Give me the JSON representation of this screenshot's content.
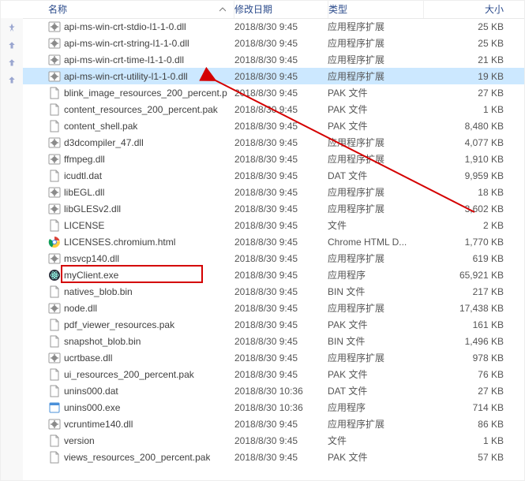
{
  "columns": {
    "name": "名称",
    "date": "修改日期",
    "type": "类型",
    "size": "大小"
  },
  "files": [
    {
      "icon": "gear",
      "name": "api-ms-win-crt-stdio-l1-1-0.dll",
      "date": "2018/8/30 9:45",
      "type": "应用程序扩展",
      "size": "25 KB"
    },
    {
      "icon": "gear",
      "name": "api-ms-win-crt-string-l1-1-0.dll",
      "date": "2018/8/30 9:45",
      "type": "应用程序扩展",
      "size": "25 KB"
    },
    {
      "icon": "gear",
      "name": "api-ms-win-crt-time-l1-1-0.dll",
      "date": "2018/8/30 9:45",
      "type": "应用程序扩展",
      "size": "21 KB"
    },
    {
      "icon": "gear",
      "name": "api-ms-win-crt-utility-l1-1-0.dll",
      "date": "2018/8/30 9:45",
      "type": "应用程序扩展",
      "size": "19 KB",
      "selected": true
    },
    {
      "icon": "file",
      "name": "blink_image_resources_200_percent.p",
      "date": "2018/8/30 9:45",
      "type": "PAK 文件",
      "size": "27 KB"
    },
    {
      "icon": "file",
      "name": "content_resources_200_percent.pak",
      "date": "2018/8/30 9:45",
      "type": "PAK 文件",
      "size": "1 KB"
    },
    {
      "icon": "file",
      "name": "content_shell.pak",
      "date": "2018/8/30 9:45",
      "type": "PAK 文件",
      "size": "8,480 KB"
    },
    {
      "icon": "gear",
      "name": "d3dcompiler_47.dll",
      "date": "2018/8/30 9:45",
      "type": "应用程序扩展",
      "size": "4,077 KB"
    },
    {
      "icon": "gear",
      "name": "ffmpeg.dll",
      "date": "2018/8/30 9:45",
      "type": "应用程序扩展",
      "size": "1,910 KB"
    },
    {
      "icon": "file",
      "name": "icudtl.dat",
      "date": "2018/8/30 9:45",
      "type": "DAT 文件",
      "size": "9,959 KB"
    },
    {
      "icon": "gear",
      "name": "libEGL.dll",
      "date": "2018/8/30 9:45",
      "type": "应用程序扩展",
      "size": "18 KB"
    },
    {
      "icon": "gear",
      "name": "libGLESv2.dll",
      "date": "2018/8/30 9:45",
      "type": "应用程序扩展",
      "size": "3,602 KB"
    },
    {
      "icon": "file",
      "name": "LICENSE",
      "date": "2018/8/30 9:45",
      "type": "文件",
      "size": "2 KB"
    },
    {
      "icon": "chrome",
      "name": "LICENSES.chromium.html",
      "date": "2018/8/30 9:45",
      "type": "Chrome HTML D...",
      "size": "1,770 KB"
    },
    {
      "icon": "gear",
      "name": "msvcp140.dll",
      "date": "2018/8/30 9:45",
      "type": "应用程序扩展",
      "size": "619 KB"
    },
    {
      "icon": "electron",
      "name": "myClient.exe",
      "date": "2018/8/30 9:45",
      "type": "应用程序",
      "size": "65,921 KB",
      "highlighted": true
    },
    {
      "icon": "file",
      "name": "natives_blob.bin",
      "date": "2018/8/30 9:45",
      "type": "BIN 文件",
      "size": "217 KB"
    },
    {
      "icon": "gear",
      "name": "node.dll",
      "date": "2018/8/30 9:45",
      "type": "应用程序扩展",
      "size": "17,438 KB"
    },
    {
      "icon": "file",
      "name": "pdf_viewer_resources.pak",
      "date": "2018/8/30 9:45",
      "type": "PAK 文件",
      "size": "161 KB"
    },
    {
      "icon": "file",
      "name": "snapshot_blob.bin",
      "date": "2018/8/30 9:45",
      "type": "BIN 文件",
      "size": "1,496 KB"
    },
    {
      "icon": "gear",
      "name": "ucrtbase.dll",
      "date": "2018/8/30 9:45",
      "type": "应用程序扩展",
      "size": "978 KB"
    },
    {
      "icon": "file",
      "name": "ui_resources_200_percent.pak",
      "date": "2018/8/30 9:45",
      "type": "PAK 文件",
      "size": "76 KB"
    },
    {
      "icon": "file",
      "name": "unins000.dat",
      "date": "2018/8/30 10:36",
      "type": "DAT 文件",
      "size": "27 KB"
    },
    {
      "icon": "exe",
      "name": "unins000.exe",
      "date": "2018/8/30 10:36",
      "type": "应用程序",
      "size": "714 KB"
    },
    {
      "icon": "gear",
      "name": "vcruntime140.dll",
      "date": "2018/8/30 9:45",
      "type": "应用程序扩展",
      "size": "86 KB"
    },
    {
      "icon": "file",
      "name": "version",
      "date": "2018/8/30 9:45",
      "type": "文件",
      "size": "1 KB"
    },
    {
      "icon": "file",
      "name": "views_resources_200_percent.pak",
      "date": "2018/8/30 9:45",
      "type": "PAK 文件",
      "size": "57 KB"
    }
  ],
  "annotations": {
    "arrow": {
      "from_file": "api-ms-win-crt-utility-l1-1-0.dll",
      "direction": "down-right"
    },
    "highlight_file": "myClient.exe"
  }
}
